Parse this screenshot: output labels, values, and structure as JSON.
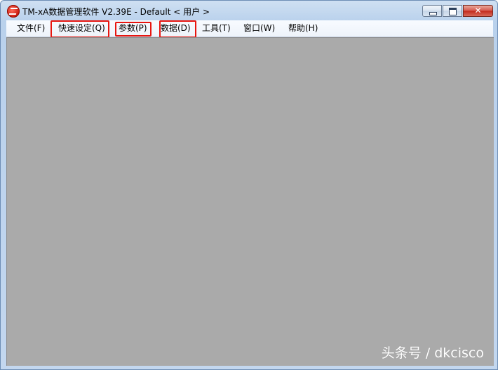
{
  "window": {
    "title": "TM-xA数据管理软件 V2.39E - Default < 用户 >",
    "icon": "app-logo-icon",
    "controls": {
      "minimize_icon": "minimize-icon",
      "maximize_icon": "maximize-icon",
      "close_label": "✕"
    }
  },
  "menubar": {
    "items": [
      {
        "label": "文件(F)",
        "highlighted": false
      },
      {
        "label": "快速设定(Q)",
        "highlighted": true
      },
      {
        "label": "参数(P)",
        "highlighted": true
      },
      {
        "label": "数据(D)",
        "highlighted": true
      },
      {
        "label": "工具(T)",
        "highlighted": false
      },
      {
        "label": "窗口(W)",
        "highlighted": false
      },
      {
        "label": "帮助(H)",
        "highlighted": false
      }
    ]
  },
  "watermark": {
    "text": "头条号 / dkcisco"
  },
  "colors": {
    "client_background": "#aaaaaa",
    "highlight_border": "#e8150f",
    "watermark": "#ffffff"
  }
}
